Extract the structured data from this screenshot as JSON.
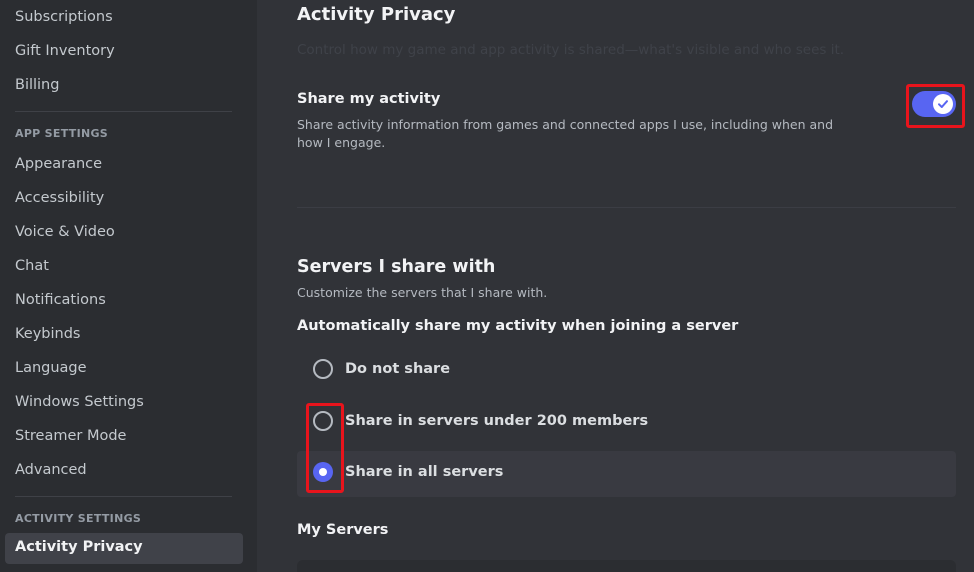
{
  "sidebar": {
    "top_items": [
      "Subscriptions",
      "Gift Inventory",
      "Billing"
    ],
    "app_settings_header": "APP SETTINGS",
    "app_items": [
      "Appearance",
      "Accessibility",
      "Voice & Video",
      "Chat",
      "Notifications",
      "Keybinds",
      "Language",
      "Windows Settings",
      "Streamer Mode",
      "Advanced"
    ],
    "activity_settings_header": "ACTIVITY SETTINGS",
    "selected_item": "Activity Privacy"
  },
  "main": {
    "title": "Activity Privacy",
    "description": "Control how my game and app activity is shared—what's visible and who sees it.",
    "share_activity": {
      "title": "Share my activity",
      "description": "Share activity information from games and connected apps I use, including when and how I engage.",
      "enabled": true
    },
    "servers": {
      "title": "Servers I share with",
      "description": "Customize the servers that I share with.",
      "auto_label": "Automatically share my activity when joining a server",
      "options": [
        "Do not share",
        "Share in servers under 200 members",
        "Share in all servers"
      ],
      "selected_option": "Share in all servers"
    },
    "my_servers_label": "My Servers"
  },
  "colors": {
    "accent": "#5865f2",
    "highlight": "#e8141c",
    "background": "#313338",
    "sidebar": "#2b2d31"
  },
  "icons": {
    "toggle_check": "check-icon"
  }
}
